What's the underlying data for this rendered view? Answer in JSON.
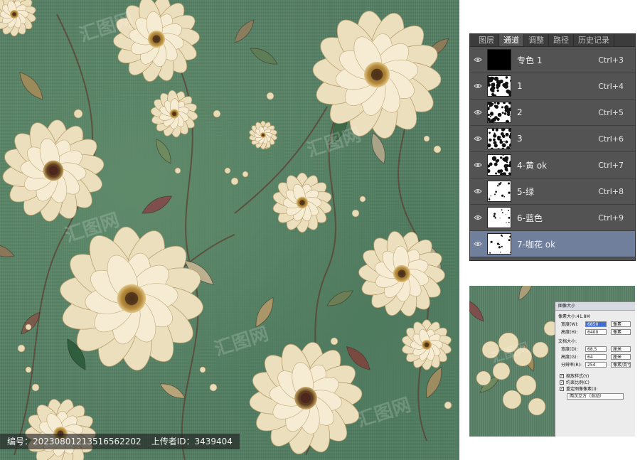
{
  "artwork": {
    "caption": {
      "id_label": "编号：20230801213516562202",
      "uploader_label": "上传者ID：3439404"
    },
    "watermark_text": "汇图网"
  },
  "channels_panel": {
    "tabs": [
      {
        "label": "图层",
        "active": false
      },
      {
        "label": "通道",
        "active": true
      },
      {
        "label": "调整",
        "active": false
      },
      {
        "label": "路径",
        "active": false
      },
      {
        "label": "历史记录",
        "active": false
      }
    ],
    "channels": [
      {
        "name": "专色 1",
        "shortcut": "Ctrl+3",
        "thumb": "black",
        "selected": false
      },
      {
        "name": "1",
        "shortcut": "Ctrl+4",
        "thumb": "pattern",
        "selected": false
      },
      {
        "name": "2",
        "shortcut": "Ctrl+5",
        "thumb": "pattern",
        "selected": false
      },
      {
        "name": "3",
        "shortcut": "Ctrl+6",
        "thumb": "pattern",
        "selected": false
      },
      {
        "name": "4-黄 ok",
        "shortcut": "Ctrl+7",
        "thumb": "pattern",
        "selected": false
      },
      {
        "name": "5-绿",
        "shortcut": "Ctrl+8",
        "thumb": "light",
        "selected": false
      },
      {
        "name": "6-蓝色",
        "shortcut": "Ctrl+9",
        "thumb": "light",
        "selected": false
      },
      {
        "name": "7-咖花 ok",
        "shortcut": "",
        "thumb": "light",
        "selected": true
      }
    ]
  },
  "image_size_dialog": {
    "title": "图像大小",
    "pixel_size": "像素大小:41.8M",
    "width_label": "宽度(W):",
    "width_value": "6850",
    "width_unit": "像素",
    "height_label": "高度(H):",
    "height_value": "6400",
    "height_unit": "像素",
    "doc_size": "文档大小:",
    "doc_width_label": "宽度(D):",
    "doc_width_value": "68.5",
    "doc_width_unit": "厘米",
    "doc_height_label": "高度(G):",
    "doc_height_value": "64",
    "doc_height_unit": "厘米",
    "resolution_label": "分辨率(R):",
    "resolution_value": "254",
    "resolution_unit": "像素/英寸",
    "scale_styles": "缩放样式(Y)",
    "constrain": "约束比例(C)",
    "resample": "重定图像像素(I):",
    "resample_method": "两次立方（自动）"
  },
  "colors": {
    "panel_bg": "#535353",
    "tab_bar_bg": "#3c3c3c",
    "selected_row": "#6f7f9c",
    "fabric_green": "#557f64",
    "petal_cream": "#efe2c2"
  }
}
